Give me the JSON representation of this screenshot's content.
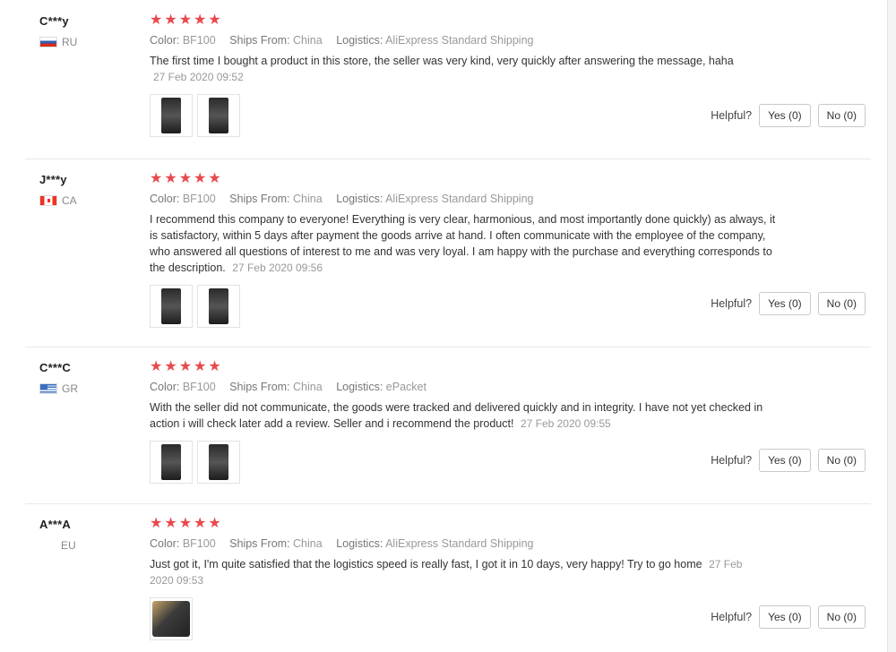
{
  "labels": {
    "color": "Color:",
    "ships_from": "Ships From:",
    "logistics": "Logistics:",
    "helpful": "Helpful?"
  },
  "reviews": [
    {
      "user": "C***y",
      "country": "RU",
      "flag": "ru-flag",
      "rating": 5,
      "stars": "★★★★★",
      "color": "BF100",
      "ships_from": "China",
      "logistics": "AliExpress Standard Shipping",
      "text": "The first time I bought a product in this store, the seller was very kind, very quickly after answering the message, haha",
      "date": "27 Feb 2020 09:52",
      "yes": "Yes (0)",
      "no": "No (0)"
    },
    {
      "user": "J***y",
      "country": "CA",
      "flag": "ca-flag",
      "rating": 5,
      "stars": "★★★★★",
      "color": "BF100",
      "ships_from": "China",
      "logistics": "AliExpress Standard Shipping",
      "text": "I recommend this company to everyone! Everything is very clear, harmonious, and most importantly done quickly) as always, it is satisfactory, within 5 days after payment the goods arrive at hand. I often communicate with the employee of the company, who answered all questions of interest to me and was very loyal. I am happy with the purchase and everything corresponds to the description.",
      "date": "27 Feb 2020 09:56",
      "yes": "Yes (0)",
      "no": "No (0)"
    },
    {
      "user": "C***C",
      "country": "GR",
      "flag": "gr-flag",
      "rating": 5,
      "stars": "★★★★★",
      "color": "BF100",
      "ships_from": "China",
      "logistics": "ePacket",
      "text": "With the seller did not communicate, the goods were tracked and delivered quickly and in integrity. I have not yet checked in action i will check later add a review. Seller and i recommend the product!",
      "date": "27 Feb 2020 09:55",
      "yes": "Yes (0)",
      "no": "No (0)"
    },
    {
      "user": "A***A",
      "country": "EU",
      "flag": "",
      "rating": 5,
      "stars": "★★★★★",
      "color": "BF100",
      "ships_from": "China",
      "logistics": "AliExpress Standard Shipping",
      "text": "Just got it, I'm quite satisfied that the logistics speed is really fast, I got it in 10 days, very happy! Try to go home",
      "date": "27 Feb 2020 09:53",
      "yes": "Yes (0)",
      "no": "No (0)"
    }
  ]
}
